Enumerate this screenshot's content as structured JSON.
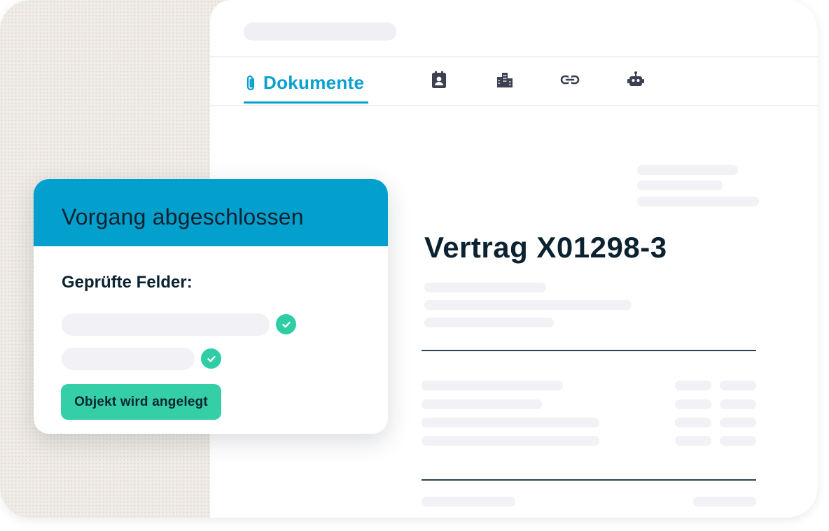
{
  "tabs": {
    "active_label": "Dokumente",
    "icons": [
      "paperclip-icon",
      "contact-card-icon",
      "buildings-icon",
      "link-icon",
      "robot-icon"
    ]
  },
  "document": {
    "title": "Vertrag X01298-3"
  },
  "status_card": {
    "title": "Vorgang abgeschlossen",
    "fields_label": "Geprüfte Felder:",
    "action_label": "Objekt wird angelegt"
  },
  "colors": {
    "accent_blue": "#03a0cd",
    "success_green": "#34cfa6",
    "title_text": "#0c2230"
  }
}
